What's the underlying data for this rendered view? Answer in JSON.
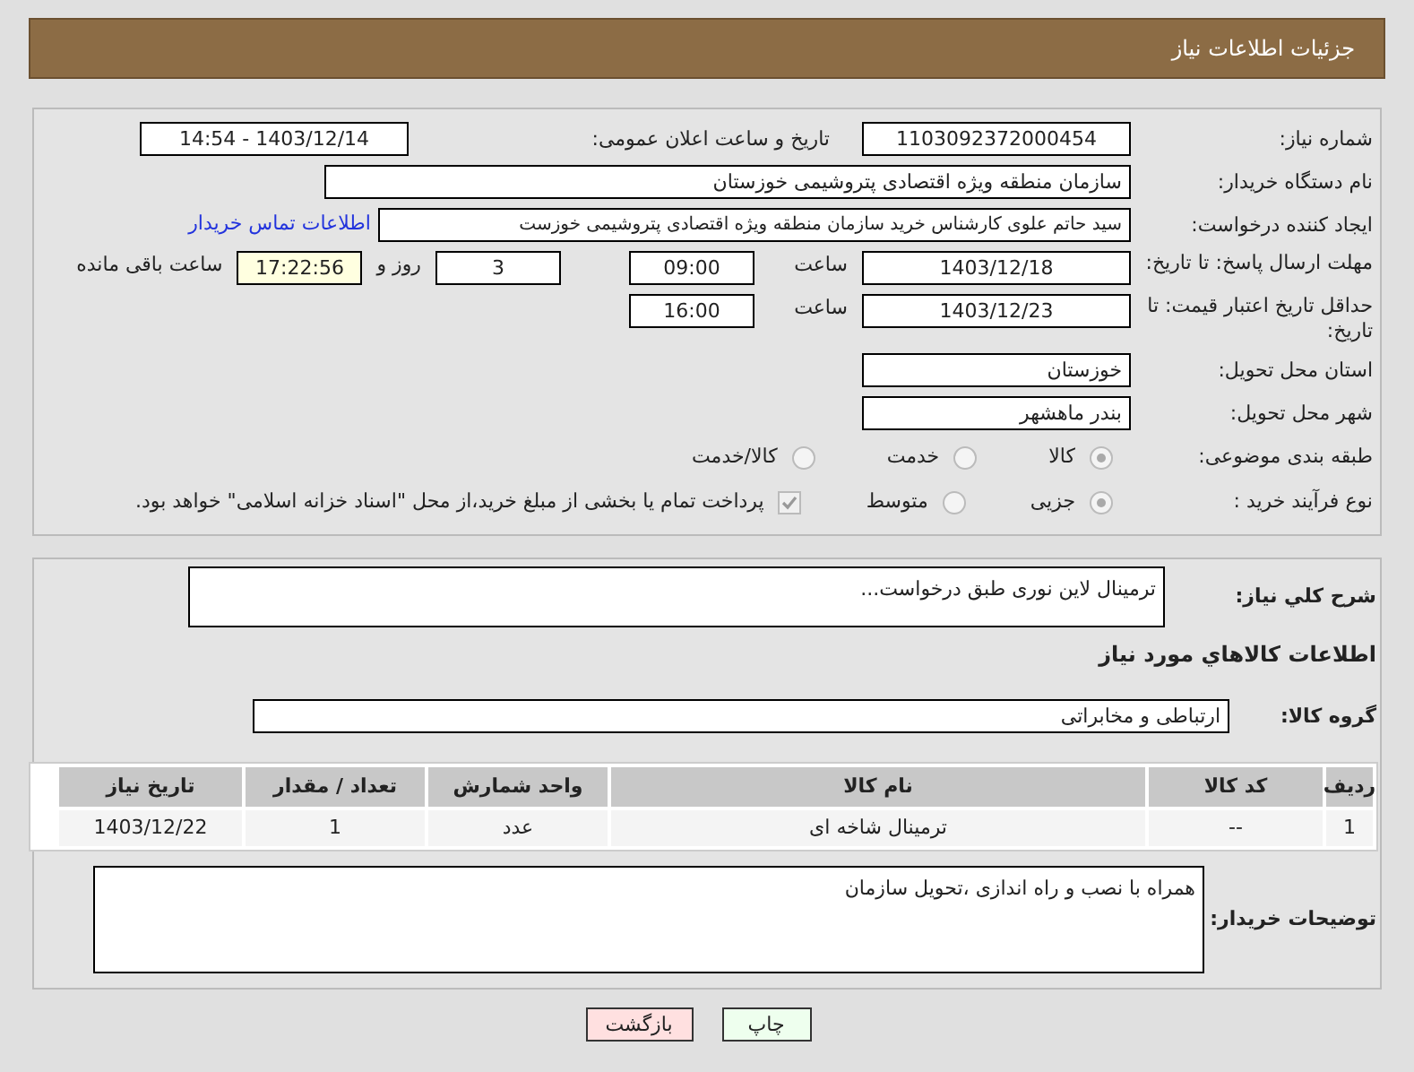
{
  "header": {
    "title": "جزئیات اطلاعات نیاز"
  },
  "need_number": {
    "label": "شماره نیاز:",
    "value": "1103092372000454"
  },
  "announce": {
    "label": "تاریخ و ساعت اعلان عمومی:",
    "value": "1403/12/14 - 14:54"
  },
  "buyer_org": {
    "label": "نام دستگاه خریدار:",
    "value": "سازمان منطقه ویژه اقتصادی پتروشیمی خوزستان"
  },
  "creator": {
    "label": "ایجاد کننده درخواست:",
    "value": "سید حاتم علوی کارشناس خرید سازمان منطقه ویژه اقتصادی پتروشیمی خوزست",
    "link": "اطلاعات تماس خریدار"
  },
  "reply_deadline": {
    "label": "مهلت ارسال پاسخ: تا تاریخ:",
    "date": "1403/12/18",
    "time_label": "ساعت",
    "time": "09:00",
    "days": "3",
    "days_label": "روز و",
    "remaining": "17:22:56",
    "remaining_label": "ساعت باقی مانده"
  },
  "price_validity": {
    "label": "حداقل تاریخ اعتبار قیمت: تا تاریخ:",
    "date": "1403/12/23",
    "time_label": "ساعت",
    "time": "16:00"
  },
  "province": {
    "label": "استان محل تحویل:",
    "value": "خوزستان"
  },
  "city": {
    "label": "شهر محل تحویل:",
    "value": "بندر ماهشهر"
  },
  "category": {
    "label": "طبقه بندی موضوعی:",
    "options": [
      {
        "label": "کالا",
        "selected": true
      },
      {
        "label": "خدمت",
        "selected": false
      },
      {
        "label": "کالا/خدمت",
        "selected": false
      }
    ]
  },
  "process": {
    "label": "نوع فرآیند خرید :",
    "options": [
      {
        "label": "جزیی",
        "selected": true
      },
      {
        "label": "متوسط",
        "selected": false
      }
    ],
    "payment": {
      "checked": true,
      "label": "پرداخت تمام یا بخشی از مبلغ خرید،از محل \"اسناد خزانه اسلامی\" خواهد بود."
    }
  },
  "description": {
    "label": "شرح کلي نياز:",
    "value": "ترمینال لاین نوری طبق درخواست..."
  },
  "goods_title": "اطلاعات کالاهاي مورد نياز",
  "goods_group": {
    "label": "گروه کالا:",
    "value": "ارتباطی و مخابراتی"
  },
  "table": {
    "columns": [
      "ردیف",
      "کد کالا",
      "نام کالا",
      "واحد شمارش",
      "تعداد / مقدار",
      "تاریخ نیاز"
    ],
    "rows": [
      [
        "1",
        "--",
        "ترمینال شاخه ای",
        "عدد",
        "1",
        "1403/12/22"
      ]
    ]
  },
  "buyer_notes": {
    "label": "توضیحات خریدار:",
    "value": "همراه با نصب و راه اندازی ،تحویل سازمان"
  },
  "buttons": [
    {
      "label": "چاپ",
      "kind": "print"
    },
    {
      "label": "بازگشت",
      "kind": "back"
    }
  ]
}
